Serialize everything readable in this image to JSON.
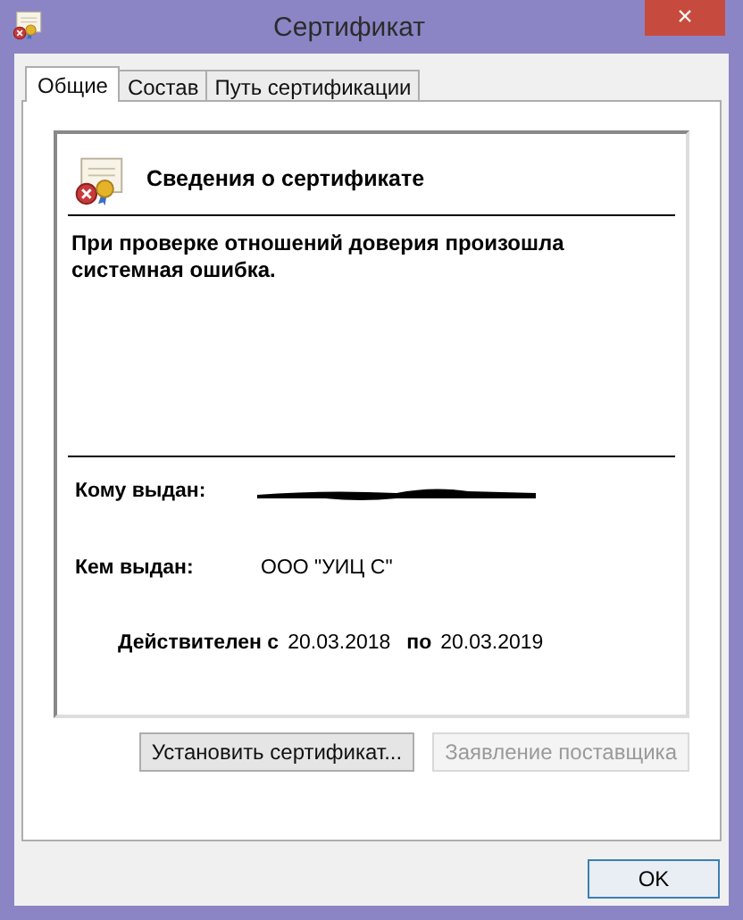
{
  "window": {
    "title": "Сертификат",
    "close": "×"
  },
  "tabs": [
    {
      "label": "Общие",
      "selected": true
    },
    {
      "label": "Состав",
      "selected": false
    },
    {
      "label": "Путь сертификации",
      "selected": false
    }
  ],
  "certificate": {
    "heading": "Сведения о сертификате",
    "message": "При проверке отношений доверия произошла системная ошибка.",
    "issued_to_label": "Кому выдан:",
    "issued_by_label": "Кем выдан:",
    "issued_by": "ООО \"УИЦ С\"",
    "valid_from_label": "Действителен с",
    "valid_from": "20.03.2018",
    "valid_to_label": "по",
    "valid_to": "20.03.2019"
  },
  "buttons": [
    {
      "label": "Установить сертификат...",
      "disabled": false
    },
    {
      "label": "Заявление поставщика",
      "disabled": true
    }
  ],
  "ok_button": "OK"
}
